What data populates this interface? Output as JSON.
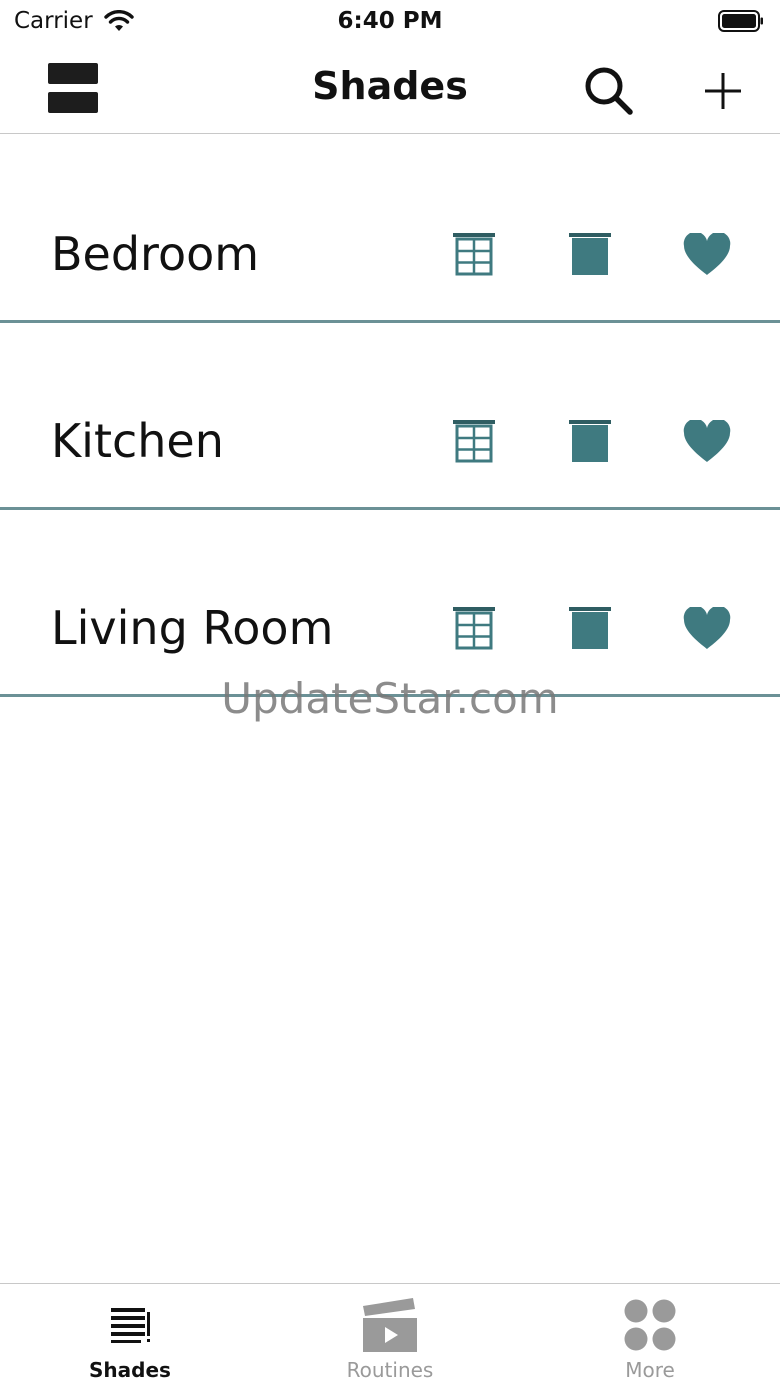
{
  "status_bar": {
    "carrier": "Carrier",
    "time": "6:40 PM"
  },
  "nav": {
    "title": "Shades",
    "icons": [
      "menu-icon",
      "search-icon",
      "add-icon"
    ]
  },
  "rooms": [
    {
      "name": "Bedroom"
    },
    {
      "name": "Kitchen"
    },
    {
      "name": "Living Room"
    }
  ],
  "row_icons": [
    "window-icon",
    "shade-icon",
    "heart-icon"
  ],
  "watermark": "UpdateStar.com",
  "tabs": [
    {
      "label": "Shades",
      "icon": "shades-list-icon",
      "active": true
    },
    {
      "label": "Routines",
      "icon": "clapperboard-icon",
      "active": false
    },
    {
      "label": "More",
      "icon": "four-dots-icon",
      "active": false
    }
  ],
  "colors": {
    "accent": "#3f7a80",
    "divider": "#6b9196",
    "inactive": "#9a9a9a",
    "text": "#111111"
  }
}
